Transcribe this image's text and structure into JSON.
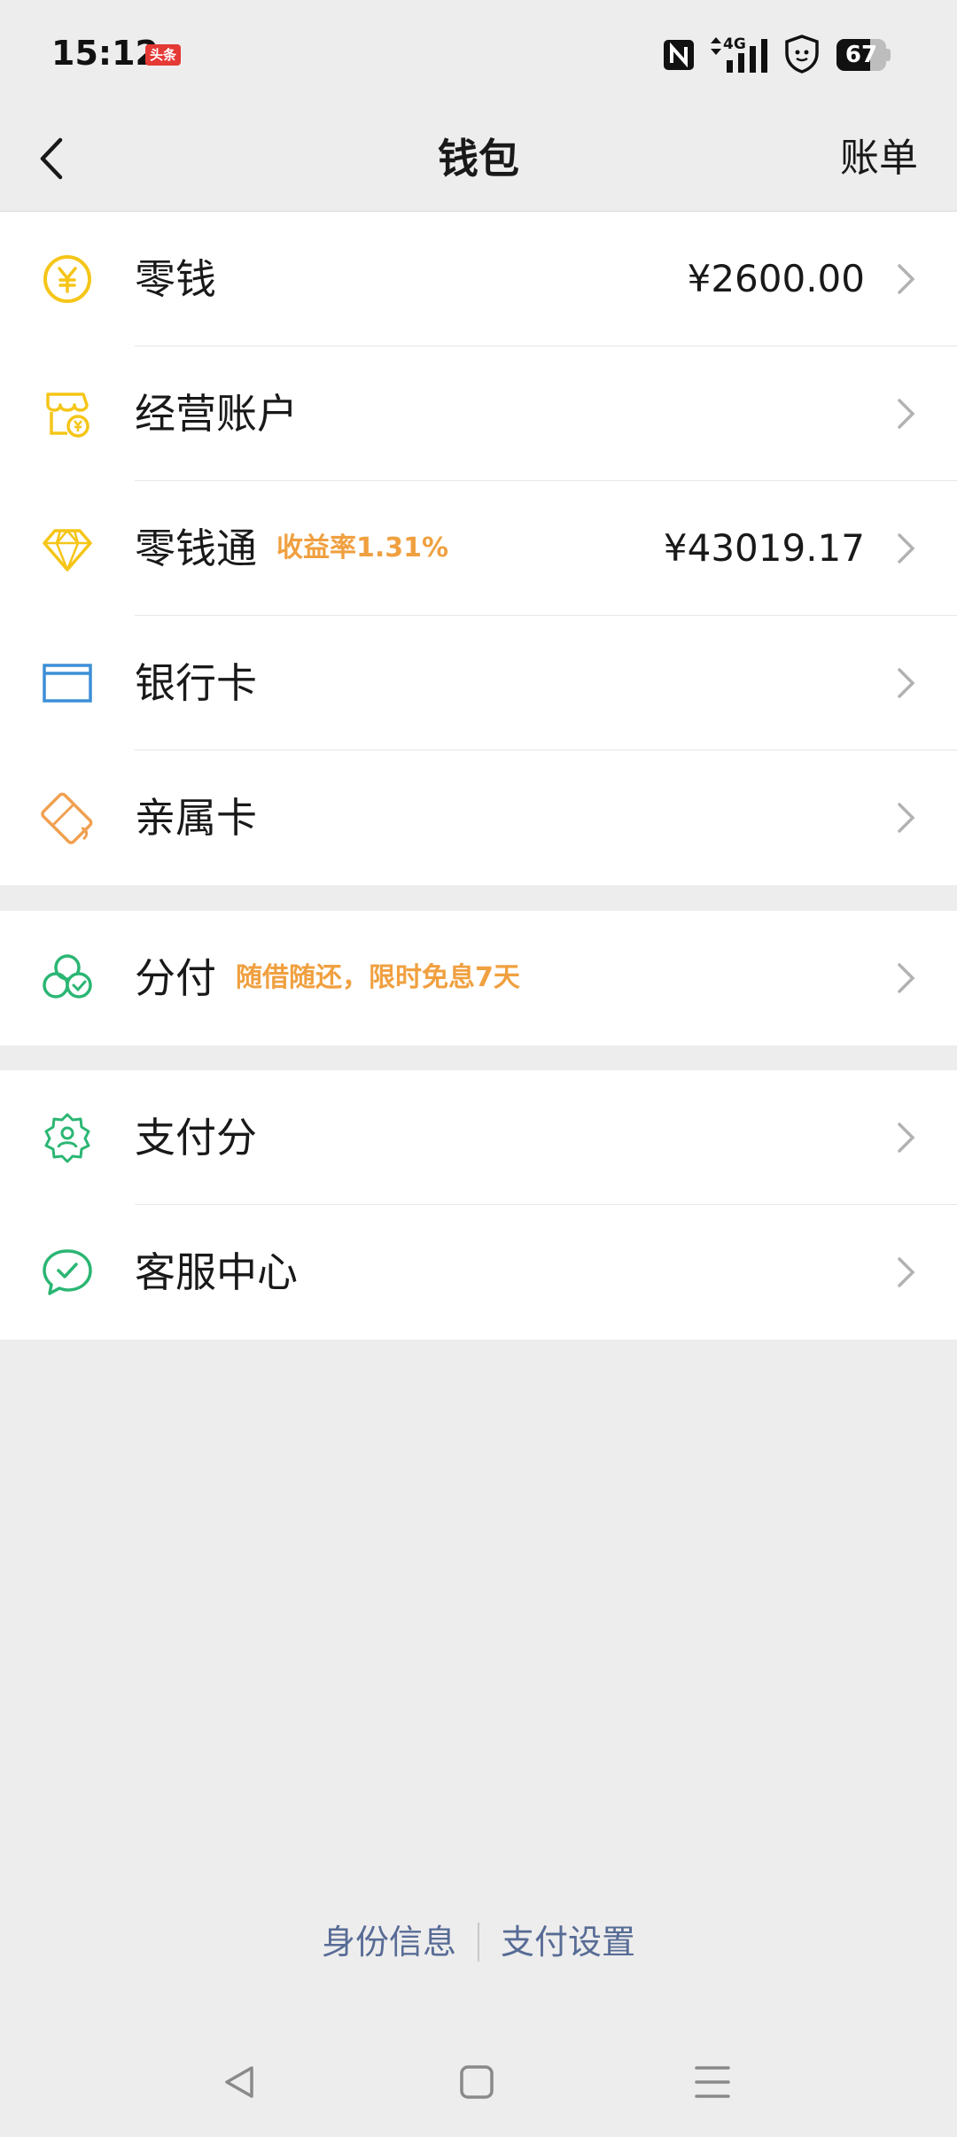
{
  "status_bar": {
    "time": "15:12",
    "notification_badge": "头条",
    "network": "4G",
    "battery": "67"
  },
  "navbar": {
    "title": "钱包",
    "right_label": "账单"
  },
  "section1": [
    {
      "label": "零钱",
      "value": "¥2600.00",
      "icon": "yuan-coin-icon",
      "color": "#f5c518"
    },
    {
      "label": "经营账户",
      "value": "",
      "icon": "shop-icon",
      "color": "#f5c518"
    },
    {
      "label": "零钱通",
      "tag": "收益率1.31%",
      "value": "¥43019.17",
      "icon": "diamond-icon",
      "color": "#f5c518"
    },
    {
      "label": "银行卡",
      "value": "",
      "icon": "bank-card-icon",
      "color": "#3d8fd6"
    },
    {
      "label": "亲属卡",
      "value": "",
      "icon": "family-card-icon",
      "color": "#f0a050"
    }
  ],
  "section2": [
    {
      "label": "分付",
      "tag": "随借随还，限时免息7天",
      "icon": "fenfu-icon",
      "color": "#2bb673"
    }
  ],
  "section3": [
    {
      "label": "支付分",
      "icon": "payscore-icon",
      "color": "#2bb673"
    },
    {
      "label": "客服中心",
      "icon": "customer-service-icon",
      "color": "#2bb673"
    }
  ],
  "footer": {
    "identity_label": "身份信息",
    "settings_label": "支付设置",
    "link_color": "#576b95"
  },
  "accent_tag_color": "#f0a040"
}
